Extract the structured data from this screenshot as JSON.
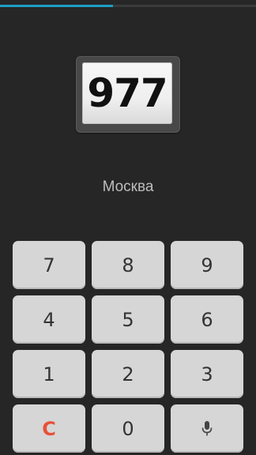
{
  "progress": {
    "fraction": 0.44,
    "color": "#1d9dc4"
  },
  "region": {
    "code": "977",
    "city": "Москва"
  },
  "keypad": {
    "keys": [
      "7",
      "8",
      "9",
      "4",
      "5",
      "6",
      "1",
      "2",
      "3",
      "C",
      "0"
    ],
    "voice_icon": "microphone-icon",
    "clear_color": "#e8503a"
  }
}
